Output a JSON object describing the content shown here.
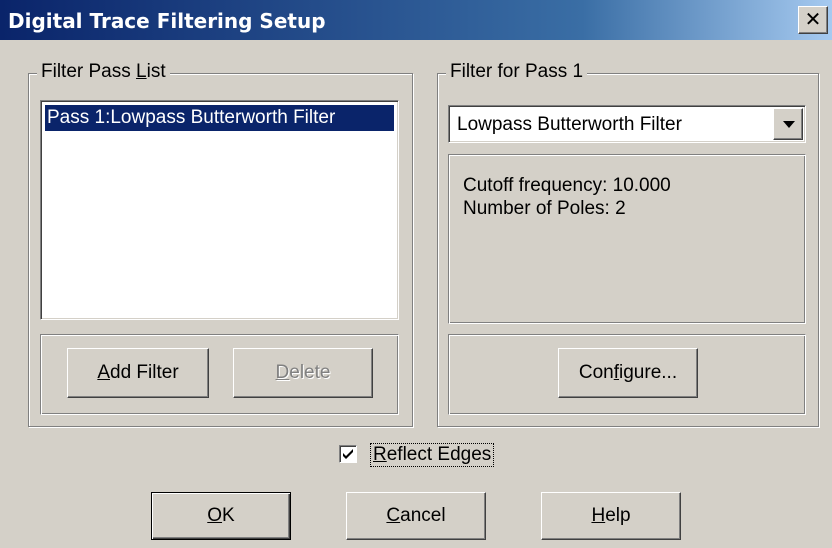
{
  "window": {
    "title": "Digital Trace Filtering Setup",
    "close_glyph": "✕"
  },
  "pass_list": {
    "legend_before": "Filter Pass ",
    "legend_mnemonic": "L",
    "legend_after": "ist",
    "items": [
      "Pass 1:Lowpass Butterworth Filter"
    ],
    "add_button": {
      "mnemonic": "A",
      "rest": "dd Filter"
    },
    "delete_button": {
      "mnemonic": "D",
      "rest": "elete"
    }
  },
  "filter_pass": {
    "legend": "Filter for Pass 1",
    "selected_filter": "Lowpass Butterworth Filter",
    "dropdown_icon": "chevron-down-icon",
    "params": [
      "Cutoff frequency: 10.000",
      "Number of Poles: 2"
    ],
    "configure_button": {
      "before": "Con",
      "mnemonic": "f",
      "after": "igure..."
    }
  },
  "reflect_edges": {
    "checked": true,
    "mnemonic": "R",
    "rest": "eflect Edges"
  },
  "buttons": {
    "ok": {
      "mnemonic": "O",
      "rest": "K"
    },
    "cancel": {
      "mnemonic": "C",
      "rest": "ancel"
    },
    "help": {
      "mnemonic": "H",
      "rest": "elp"
    }
  },
  "colors": {
    "title_start": "#0a246a",
    "title_end": "#a6caf0",
    "face": "#d4d0c8",
    "selection": "#0a246a"
  }
}
